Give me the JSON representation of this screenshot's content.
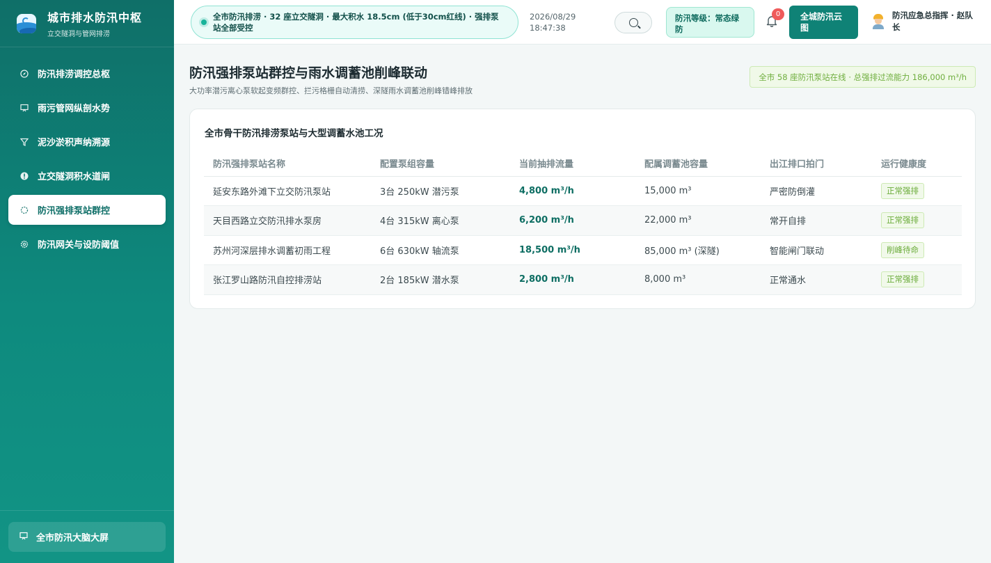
{
  "brand": {
    "title": "城市排水防汛中枢",
    "subtitle": "立交隧洞与管网排涝"
  },
  "nav": {
    "items": [
      {
        "label": "防汛排涝调控总枢",
        "icon": "compass-icon"
      },
      {
        "label": "雨污管网纵剖水势",
        "icon": "monitor-icon"
      },
      {
        "label": "泥沙淤积声纳溯源",
        "icon": "filter-icon"
      },
      {
        "label": "立交隧洞积水道闸",
        "icon": "alert-icon"
      },
      {
        "label": "防汛强排泵站群控",
        "icon": "pump-icon",
        "active": true
      },
      {
        "label": "防汛网关与设防阈值",
        "icon": "gear-icon"
      }
    ],
    "footer_label": "全市防汛大脑大屏"
  },
  "header": {
    "ticker": "全市防汛排涝 · 32 座立交隧洞 · 最大积水 18.5cm (低于30cm红线) · 强排泵站全部受控",
    "date": "2026/08/29",
    "time": "18:47:38",
    "level": "防汛等级：常态绿防",
    "notification_count": "0",
    "cloud_button": "全城防汛云图",
    "user": "防汛应急总指挥 · 赵队长"
  },
  "page": {
    "title": "防汛强排泵站群控与雨水调蓄池削峰联动",
    "subtitle": "大功率潜污离心泵软起变频群控、拦污格栅自动清捞、深隧雨水调蓄池削峰错峰排放",
    "status": "全市 58 座防汛泵站在线 · 总强排过流能力 186,000 m³/h"
  },
  "table": {
    "title": "全市骨干防汛排涝泵站与大型调蓄水池工况",
    "columns": [
      "防汛强排泵站名称",
      "配置泵组容量",
      "当前抽排流量",
      "配属调蓄池容量",
      "出江排口拍门",
      "运行健康度"
    ],
    "rows": [
      {
        "name": "延安东路外滩下立交防汛泵站",
        "capacity": "3台 250kW 潜污泵",
        "flow": "4,800 m³/h",
        "storage": "15,000 m³",
        "gate": "严密防倒灌",
        "health": "正常强排"
      },
      {
        "name": "天目西路立交防汛排水泵房",
        "capacity": "4台 315kW 离心泵",
        "flow": "6,200 m³/h",
        "storage": "22,000 m³",
        "gate": "常开自排",
        "health": "正常强排"
      },
      {
        "name": "苏州河深层排水调蓄初雨工程",
        "capacity": "6台 630kW 轴流泵",
        "flow": "18,500 m³/h",
        "storage": "85,000 m³ (深隧)",
        "gate": "智能闸门联动",
        "health": "削峰待命"
      },
      {
        "name": "张江罗山路防汛自控排涝站",
        "capacity": "2台 185kW 潜水泵",
        "flow": "2,800 m³/h",
        "storage": "8,000 m³",
        "gate": "正常通水",
        "health": "正常强排"
      }
    ]
  },
  "colors": {
    "primary": "#0f8276",
    "sidebar_top": "#0f6f68",
    "accent_green": "#6aab39",
    "badge_red": "#ef5b5b"
  }
}
